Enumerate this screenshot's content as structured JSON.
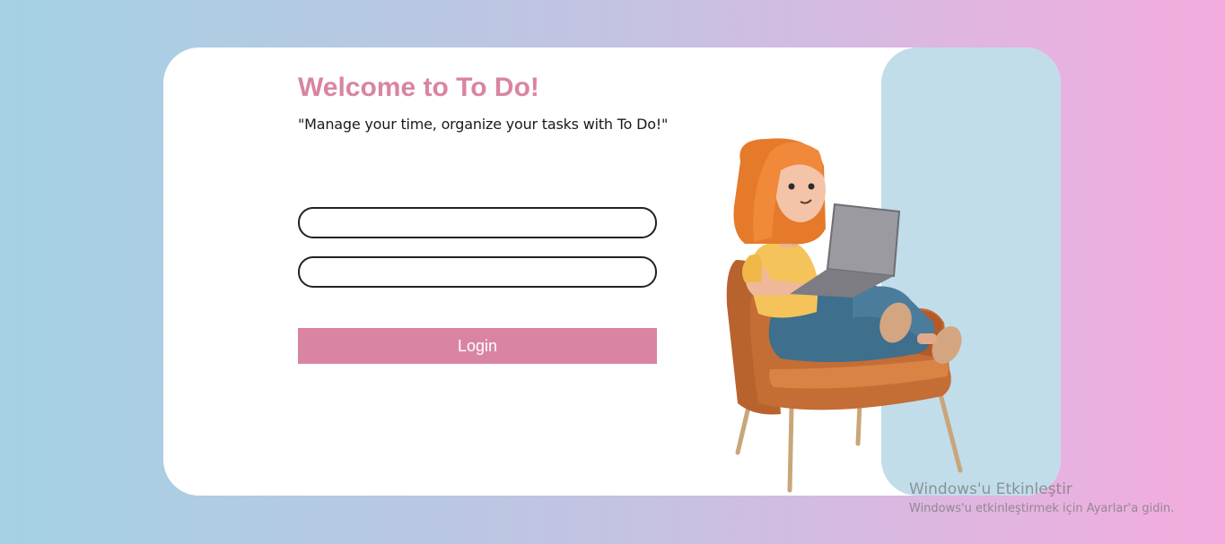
{
  "login": {
    "title": "Welcome to To Do!",
    "subtitle": "\"Manage your time, organize your tasks with To Do!\"",
    "username_value": "",
    "password_value": "",
    "button_label": "Login"
  },
  "illustration": {
    "icon": "woman-on-chair-with-laptop-illustration"
  },
  "watermark": {
    "title": "Windows'u Etkinleştir",
    "subtitle": "Windows'u etkinleştirmek için Ayarlar'a gidin."
  },
  "colors": {
    "accent": "#d984a3",
    "panel": "#c1ddea",
    "gradient_left": "#a4d1e3",
    "gradient_right": "#f4acdf"
  }
}
